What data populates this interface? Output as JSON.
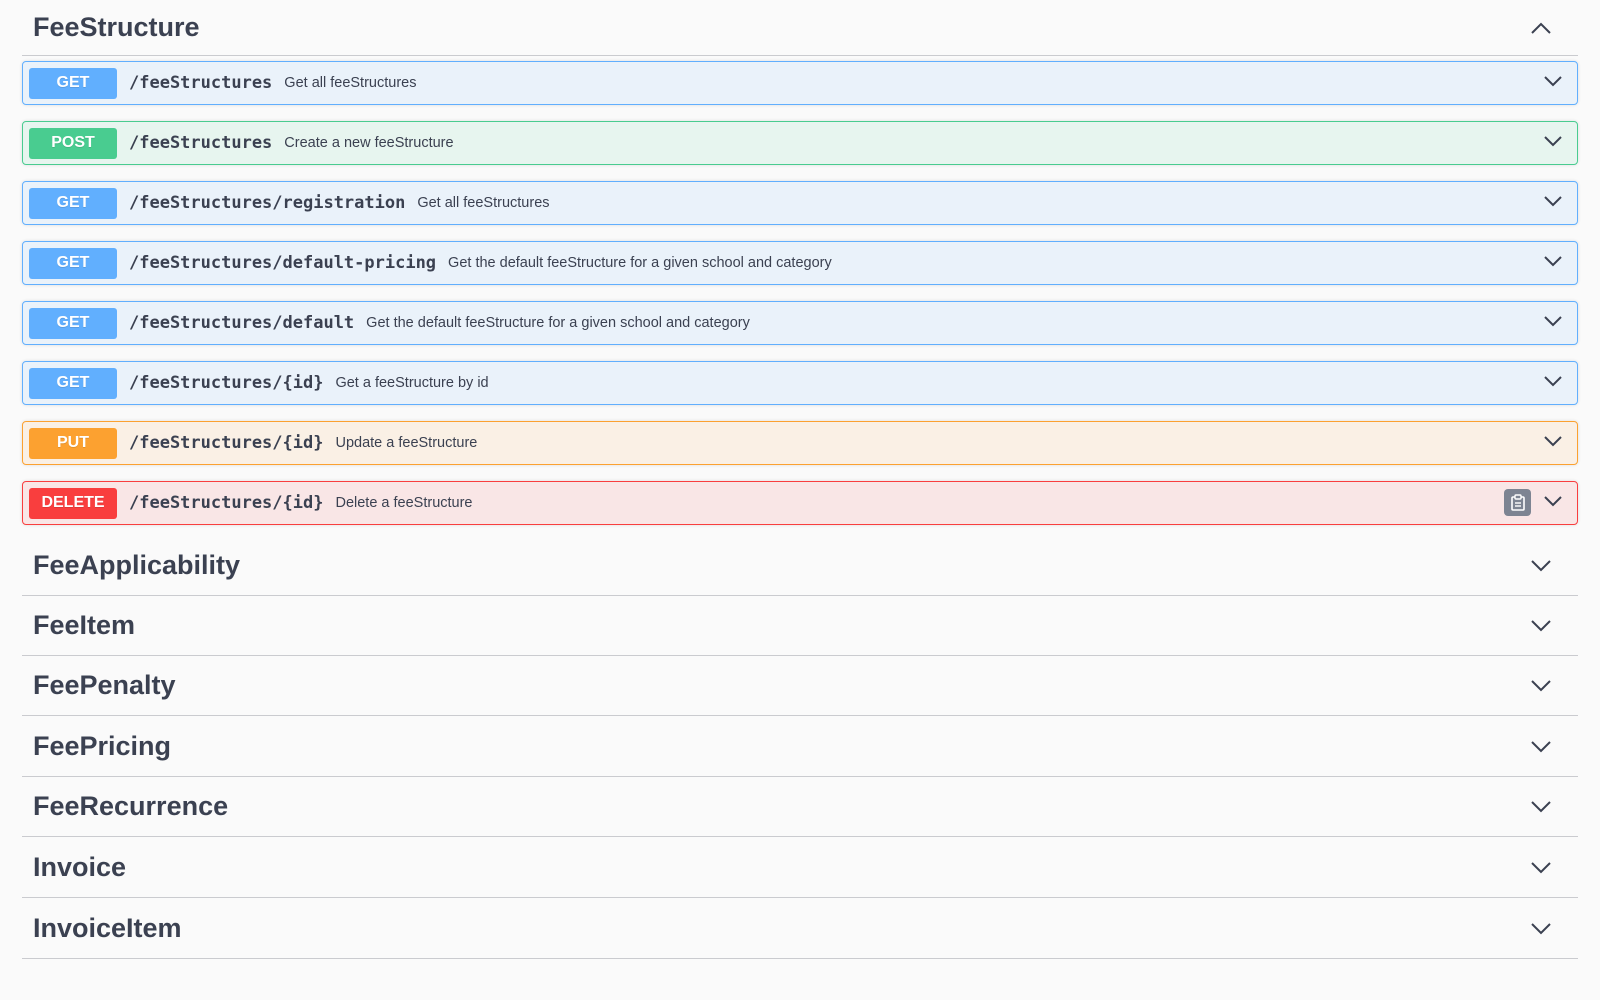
{
  "groups": [
    {
      "name": "FeeStructure",
      "expanded": true,
      "operations": [
        {
          "method": "GET",
          "path": "/feeStructures",
          "summary": "Get all feeStructures"
        },
        {
          "method": "POST",
          "path": "/feeStructures",
          "summary": "Create a new feeStructure"
        },
        {
          "method": "GET",
          "path": "/feeStructures/registration",
          "summary": "Get all feeStructures"
        },
        {
          "method": "GET",
          "path": "/feeStructures/default-pricing",
          "summary": "Get the default feeStructure for a given school and category"
        },
        {
          "method": "GET",
          "path": "/feeStructures/default",
          "summary": "Get the default feeStructure for a given school and category"
        },
        {
          "method": "GET",
          "path": "/feeStructures/{id}",
          "summary": "Get a feeStructure by id"
        },
        {
          "method": "PUT",
          "path": "/feeStructures/{id}",
          "summary": "Update a feeStructure"
        },
        {
          "method": "DELETE",
          "path": "/feeStructures/{id}",
          "summary": "Delete a feeStructure"
        }
      ]
    },
    {
      "name": "FeeApplicability",
      "expanded": false
    },
    {
      "name": "FeeItem",
      "expanded": false
    },
    {
      "name": "FeePenalty",
      "expanded": false
    },
    {
      "name": "FeePricing",
      "expanded": false
    },
    {
      "name": "FeeRecurrence",
      "expanded": false
    },
    {
      "name": "Invoice",
      "expanded": false
    },
    {
      "name": "InvoiceItem",
      "expanded": false
    }
  ],
  "icons": {
    "collapse": "chevron-up-icon",
    "expand": "chevron-down-icon",
    "copy": "clipboard-icon"
  },
  "colors": {
    "get": "#61affe",
    "post": "#49cc90",
    "put": "#fca130",
    "delete": "#f93e3e"
  }
}
